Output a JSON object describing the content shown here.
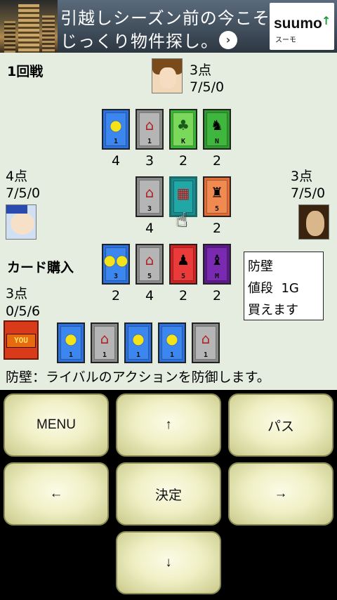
{
  "ad": {
    "line1": "引越しシーズン前の今こそ",
    "line2": "じっくり物件探し。",
    "arrow": "›",
    "logo": "suumo",
    "logo_sub": "スーモ"
  },
  "round": "1回戦",
  "opponent_top": {
    "score": "3点",
    "stats": "7/5/0"
  },
  "opponent_left": {
    "score": "4点",
    "stats": "7/5/0"
  },
  "opponent_right": {
    "score": "3点",
    "stats": "7/5/0"
  },
  "player": {
    "score": "3点",
    "stats": "0/5/6",
    "badge": "YOU"
  },
  "phase_label": "カード購入",
  "supply_row1": [
    {
      "color": "blue",
      "icon": "coin-icon",
      "glyph": "●",
      "num": "1",
      "count": "4"
    },
    {
      "color": "gray",
      "icon": "roof-icon",
      "glyph": "⌂",
      "num": "1",
      "count": "3"
    },
    {
      "color": "green",
      "icon": "tree-icon",
      "glyph": "♣",
      "num": "K",
      "count": "2"
    },
    {
      "color": "dkgreen",
      "icon": "soldier-icon",
      "glyph": "♞",
      "num": "N",
      "count": "2"
    }
  ],
  "supply_row2": [
    {
      "color": "gray",
      "icon": "roof-icon",
      "glyph": "⌂",
      "num": "3",
      "count": "4"
    },
    {
      "color": "teal",
      "icon": "wall-icon",
      "glyph": "▦",
      "num": "",
      "count": ""
    },
    {
      "color": "orange",
      "icon": "knight-icon",
      "glyph": "♜",
      "num": "5",
      "count": "2"
    }
  ],
  "supply_row3": [
    {
      "color": "blue",
      "icon": "coins-icon",
      "glyph": "●●",
      "num": "3",
      "count": "2"
    },
    {
      "color": "gray",
      "icon": "roof-icon",
      "glyph": "⌂",
      "num": "5",
      "count": "4"
    },
    {
      "color": "red",
      "icon": "warrior-icon",
      "glyph": "♟",
      "num": "5",
      "count": "2"
    },
    {
      "color": "purple",
      "icon": "demon-icon",
      "glyph": "♝",
      "num": "M",
      "count": "2"
    }
  ],
  "hand": [
    {
      "color": "blue",
      "icon": "coin-icon",
      "glyph": "●",
      "num": "1"
    },
    {
      "color": "gray",
      "icon": "roof-icon",
      "glyph": "⌂",
      "num": "1"
    },
    {
      "color": "blue",
      "icon": "coin-icon",
      "glyph": "●",
      "num": "1"
    },
    {
      "color": "blue",
      "icon": "coin-icon",
      "glyph": "●",
      "num": "1"
    },
    {
      "color": "gray",
      "icon": "roof-icon",
      "glyph": "⌂",
      "num": "1"
    }
  ],
  "info_box": {
    "name": "防壁",
    "price_label": "値段",
    "price": "1G",
    "status": "買えます"
  },
  "description": "防壁：ライバルのアクションを防御します。",
  "buttons": {
    "menu": "MENU",
    "up": "↑",
    "pass": "パス",
    "left": "←",
    "ok": "決定",
    "right": "→",
    "down": "↓"
  }
}
